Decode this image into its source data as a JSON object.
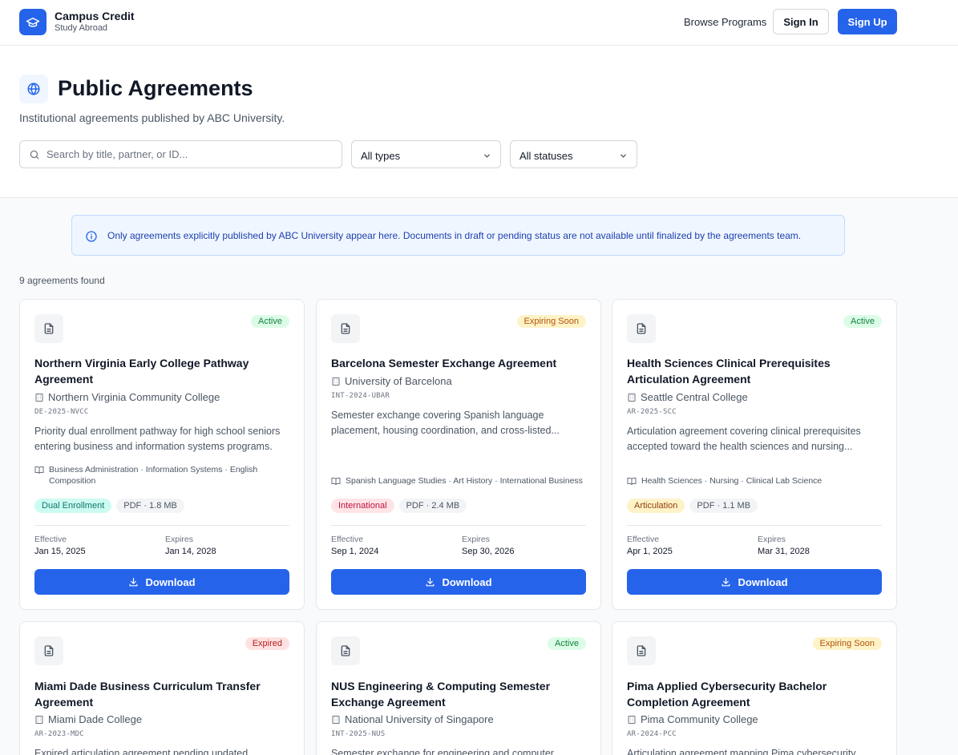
{
  "header": {
    "brand_name": "Campus Credit",
    "brand_sub": "Study Abroad",
    "nav_browse": "Browse Programs",
    "sign_in": "Sign In",
    "sign_up": "Sign Up"
  },
  "hero": {
    "title": "Public Agreements",
    "subtitle": "Institutional agreements published by ABC University.",
    "search_placeholder": "Search by title, partner, or ID...",
    "type_filter": "All types",
    "status_filter": "All statuses"
  },
  "notice": "Only agreements explicitly published by ABC University appear here. Documents in draft or pending status are not available until finalized by the agreements team.",
  "results_count": "9 agreements found",
  "labels": {
    "effective": "Effective",
    "expires": "Expires",
    "download": "Download"
  },
  "colors": {
    "primary": "#2563eb",
    "active": "#15803d",
    "expiring": "#b45309",
    "expired": "#b91c1c"
  },
  "cards": [
    {
      "status": "Active",
      "title": "Northern Virginia Early College Pathway Agreement",
      "partner": "Northern Virginia Community College",
      "id": "DE-2025-NVCC",
      "description": "Priority dual enrollment pathway for high school seniors entering business and information systems programs.",
      "programs": "Business Administration · Information Systems · English Composition",
      "type_tag": "Dual Enrollment",
      "file": "PDF · 1.8 MB",
      "effective": "Jan 15, 2025",
      "expires": "Jan 14, 2028"
    },
    {
      "status": "Expiring Soon",
      "title": "Barcelona Semester Exchange Agreement",
      "partner": "University of Barcelona",
      "id": "INT-2024-UBAR",
      "description": "Semester exchange covering Spanish language placement, housing coordination, and cross-listed...",
      "programs": "Spanish Language Studies · Art History · International Business",
      "type_tag": "International",
      "file": "PDF · 2.4 MB",
      "effective": "Sep 1, 2024",
      "expires": "Sep 30, 2026"
    },
    {
      "status": "Active",
      "title": "Health Sciences Clinical Prerequisites Articulation Agreement",
      "partner": "Seattle Central College",
      "id": "AR-2025-SCC",
      "description": "Articulation agreement covering clinical prerequisites accepted toward the health sciences and nursing...",
      "programs": "Health Sciences · Nursing · Clinical Lab Science",
      "type_tag": "Articulation",
      "file": "PDF · 1.1 MB",
      "effective": "Apr 1, 2025",
      "expires": "Mar 31, 2028"
    },
    {
      "status": "Expired",
      "title": "Miami Dade Business Curriculum Transfer Agreement",
      "partner": "Miami Dade College",
      "id": "AR-2023-MDC",
      "description": "Expired articulation agreement pending updated..."
    },
    {
      "status": "Active",
      "title": "NUS Engineering & Computing Semester Exchange Agreement",
      "partner": "National University of Singapore",
      "id": "INT-2025-NUS",
      "description": "Semester exchange for engineering and computer..."
    },
    {
      "status": "Expiring Soon",
      "title": "Pima Applied Cybersecurity Bachelor Completion Agreement",
      "partner": "Pima Community College",
      "id": "AR-2024-PCC",
      "description": "Articulation agreement mapping Pima cybersecurity..."
    }
  ]
}
